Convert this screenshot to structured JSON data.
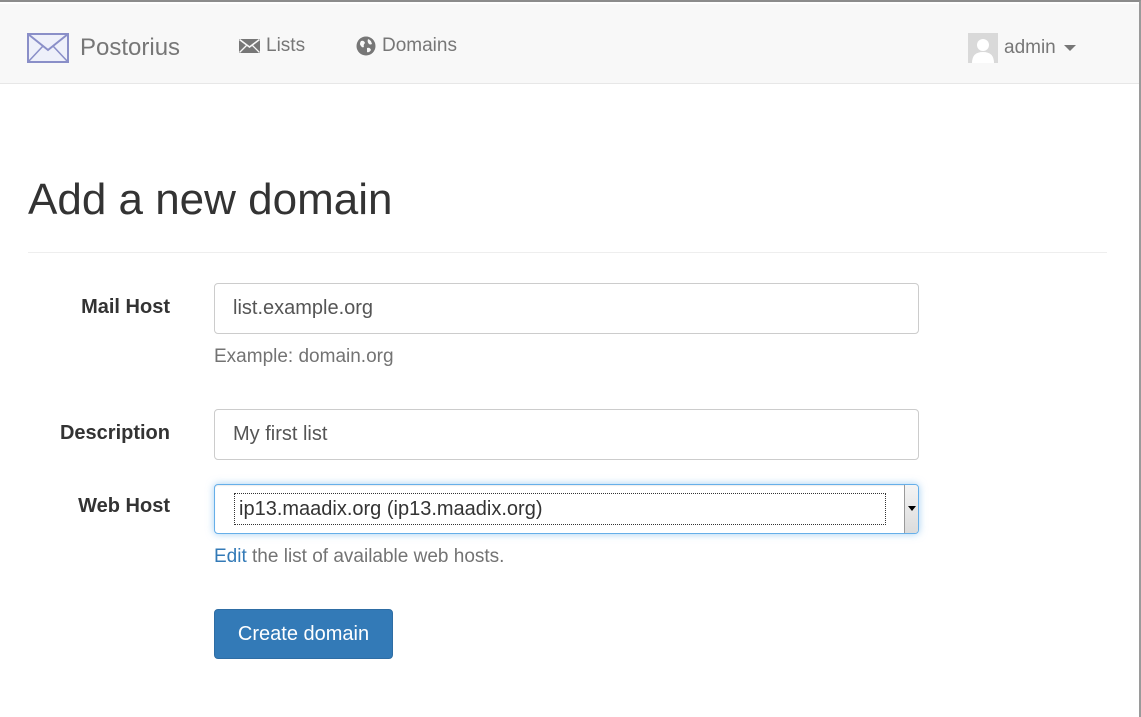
{
  "navbar": {
    "brand": "Postorius",
    "links": [
      {
        "label": "Lists",
        "icon": "envelope-icon"
      },
      {
        "label": "Domains",
        "icon": "globe-icon"
      }
    ],
    "user": {
      "name": "admin",
      "icon": "avatar"
    }
  },
  "page": {
    "title": "Add a new domain"
  },
  "form": {
    "mail_host": {
      "label": "Mail Host",
      "value": "list.example.org",
      "help": "Example: domain.org"
    },
    "description": {
      "label": "Description",
      "value": "My first list"
    },
    "web_host": {
      "label": "Web Host",
      "selected": "ip13.maadix.org (ip13.maadix.org)",
      "help_link": "Edit",
      "help_text": " the list of available web hosts."
    },
    "submit_label": "Create domain"
  },
  "colors": {
    "primary": "#337ab7",
    "navbar_bg": "#f8f8f8",
    "focus_border": "#66afe9"
  }
}
